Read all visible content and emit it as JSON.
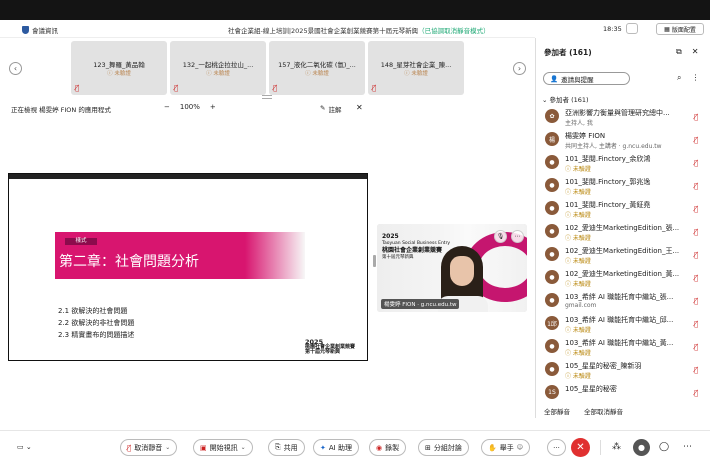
{
  "titlebar": {
    "app": "會議資訊",
    "meeting_title": "社會企業組-線上培訓|2025景國社會企業創業競賽第十屆元琴新興",
    "status_note": "（已協調取消靜音模式）",
    "time": "18:35",
    "layout_label": "版面配置"
  },
  "tiles": [
    {
      "name": "123_舞羅_黃品翰",
      "status": "未驗證"
    },
    {
      "name": "132_一起桃企拉拉山_...",
      "status": "未驗證"
    },
    {
      "name": "157_液化二氧化碳 (氫)_...",
      "status": "未驗證"
    },
    {
      "name": "148_星芽社會企業_陳...",
      "status": "未驗證"
    }
  ],
  "sharebar": {
    "viewing": "正在檢視 楊雯婷 FION 的應用程式",
    "zoom": "100%",
    "annotate": "註解"
  },
  "slide": {
    "tag": "樣式",
    "chapter": "第二章：社會問題分析",
    "bullets": [
      "2.1 欲解決的社會問題",
      "2.2 欲解決的非社會問題",
      "2.3 精實畫布的問題描述"
    ],
    "logo_year": "2025",
    "logo_line1": "桃園社會企業創業競賽",
    "logo_line2": "第十屆元琴新興"
  },
  "selfvideo": {
    "year": "2025",
    "event_en": "Taoyuan Social Business Entry",
    "event": "桃園社會企業創業競賽",
    "event_sub": "第十屆元琴新興",
    "caption": "楊雯婷 FION · g.ncu.edu.tw"
  },
  "panel": {
    "title": "參加者 (161)",
    "invite": "邀請與提醒",
    "section": "參加者 (161)",
    "participants": [
      {
        "name": "亞洲影響力衡量與管理研究總中...",
        "sub": "主持人, 我",
        "sub_style": "gray",
        "avatar": "✿"
      },
      {
        "name": "楊雯婷 FION",
        "sub": "共同主持人, 主講者 · g.ncu.edu.tw",
        "sub_style": "gray",
        "avatar": "楊"
      },
      {
        "name": "101_斐閱.Finctory_余欣鴻",
        "sub": "未驗證",
        "sub_style": "warn",
        "avatar": "●"
      },
      {
        "name": "101_斐閱.Finctory_郭兆逸",
        "sub": "未驗證",
        "sub_style": "warn",
        "avatar": "●"
      },
      {
        "name": "101_斐閱.Finctory_黃鉦堯",
        "sub": "未驗證",
        "sub_style": "warn",
        "avatar": "●"
      },
      {
        "name": "102_愛迪生MarketingEdition_張...",
        "sub": "未驗證",
        "sub_style": "warn",
        "avatar": "●"
      },
      {
        "name": "102_愛迪生MarketingEdition_王...",
        "sub": "未驗證",
        "sub_style": "warn",
        "avatar": "●"
      },
      {
        "name": "102_愛迪生MarketingEdition_黃...",
        "sub": "未驗證",
        "sub_style": "warn",
        "avatar": "●"
      },
      {
        "name": "103_希絆 AI 職能托育中繼站_張...",
        "sub": "gmail.com",
        "sub_style": "gray",
        "avatar": "●"
      },
      {
        "name": "103_希絆 AI 職能托育中繼站_邱...",
        "sub": "未驗證",
        "sub_style": "warn",
        "avatar": "1邱"
      },
      {
        "name": "103_希絆 AI 職能托育中繼站_黃...",
        "sub": "未驗證",
        "sub_style": "warn",
        "avatar": "●"
      },
      {
        "name": "105_星星的秘密_陳新羽",
        "sub": "未驗證",
        "sub_style": "warn",
        "avatar": "●"
      },
      {
        "name": "105_星星的秘密",
        "sub": "",
        "sub_style": "gray",
        "avatar": "1S"
      }
    ],
    "mute_all": "全部靜音",
    "unmute_all": "全部取消靜音"
  },
  "bottombar": {
    "unmute": "取消靜音",
    "start_video": "開始視訊",
    "share": "共用",
    "ai": "AI 助理",
    "record": "錄製",
    "breakout": "分組討論",
    "raise_hand": "舉手",
    "more": "···"
  },
  "colors": {
    "accent_pink": "#d8156f",
    "end_red": "#e03030",
    "warn": "#b8860b"
  }
}
